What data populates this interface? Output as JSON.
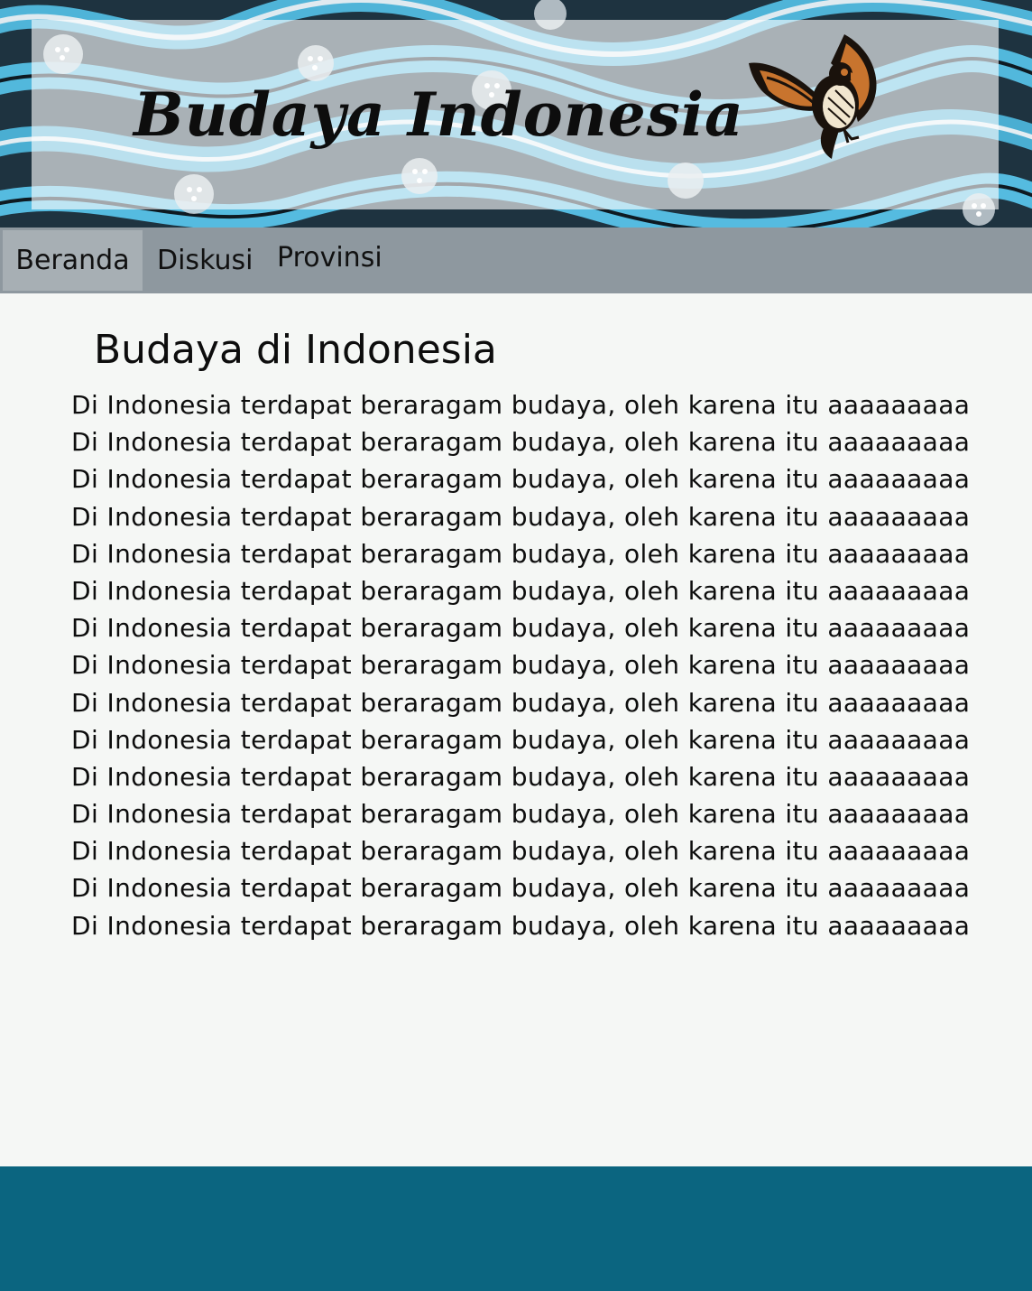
{
  "header": {
    "title": "Budaya Indonesia"
  },
  "nav": {
    "items": [
      {
        "label": "Beranda",
        "active": true
      },
      {
        "label": "Diskusi",
        "active": false
      },
      {
        "label": "Provinsi",
        "active": false
      }
    ]
  },
  "content": {
    "heading": "Budaya di Indonesia",
    "lines": [
      "Di Indonesia terdapat beraragam budaya, oleh karena itu aaaaaaaaa",
      "Di Indonesia terdapat beraragam budaya, oleh karena itu aaaaaaaaa",
      "Di Indonesia terdapat beraragam budaya, oleh karena itu aaaaaaaaa",
      "Di Indonesia terdapat beraragam budaya, oleh karena itu aaaaaaaaa",
      "Di Indonesia terdapat beraragam budaya, oleh karena itu aaaaaaaaa",
      "Di Indonesia terdapat beraragam budaya, oleh karena itu aaaaaaaaa",
      "Di Indonesia terdapat beraragam budaya, oleh karena itu aaaaaaaaa",
      "Di Indonesia terdapat beraragam budaya, oleh karena itu aaaaaaaaa",
      "Di Indonesia terdapat beraragam budaya, oleh karena itu aaaaaaaaa",
      "Di Indonesia terdapat beraragam budaya, oleh karena itu aaaaaaaaa",
      "Di Indonesia terdapat beraragam budaya, oleh karena itu aaaaaaaaa",
      "Di Indonesia terdapat beraragam budaya, oleh karena itu aaaaaaaaa",
      "Di Indonesia terdapat beraragam budaya, oleh karena itu aaaaaaaaa",
      "Di Indonesia terdapat beraragam budaya, oleh karena itu aaaaaaaaa",
      "Di Indonesia terdapat beraragam budaya, oleh karena itu aaaaaaaaa"
    ]
  },
  "colors": {
    "nav_bg": "#8e989f",
    "nav_active_bg": "#a7afb4",
    "page_bg": "#f5f7f5",
    "footer_bg": "#0b6580",
    "batik_blue": "#4fb4d8"
  },
  "icons": {
    "logo": "garuda-bird-icon",
    "banner_pattern": "batik-pattern"
  }
}
